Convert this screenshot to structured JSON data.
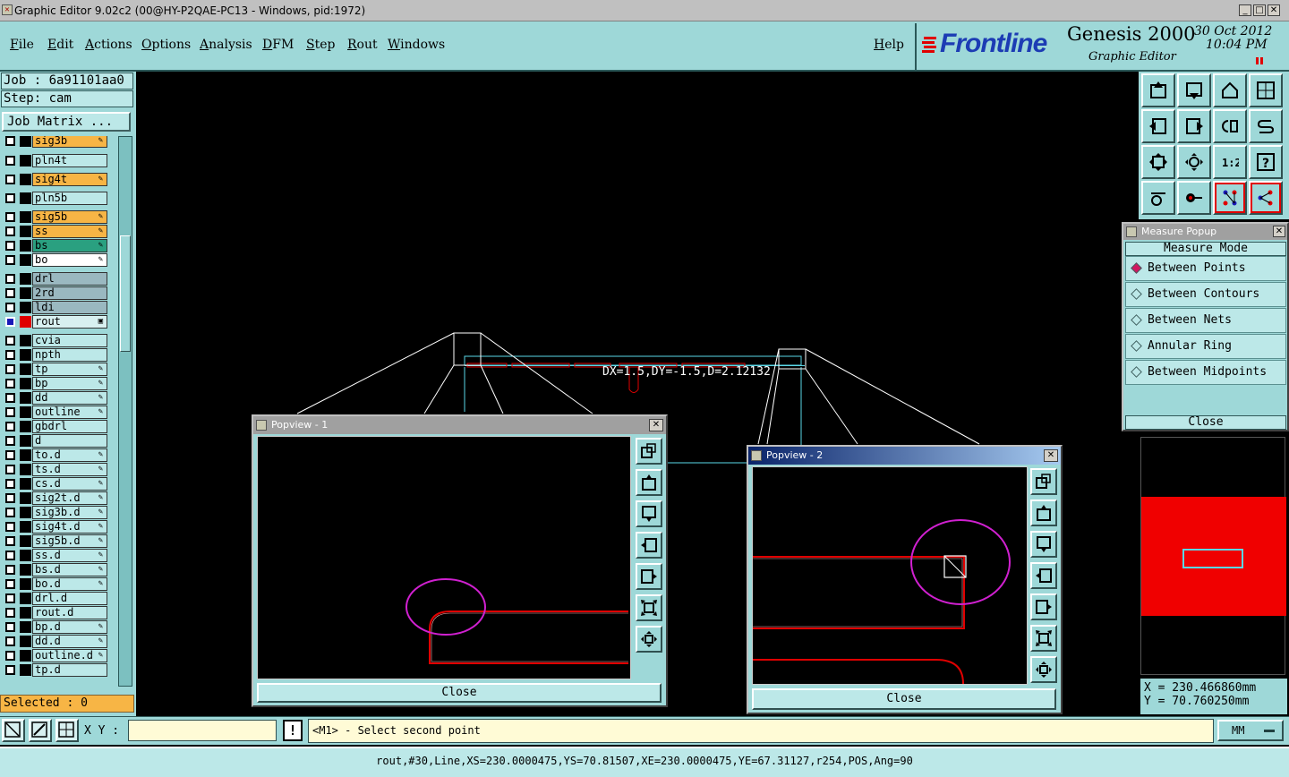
{
  "window": {
    "title": "Graphic Editor 9.02c2 (00@HY-P2QAE-PC13 - Windows, pid:1972)",
    "min": "_",
    "max": "□",
    "close": "✕"
  },
  "menu": {
    "items": [
      "File",
      "Edit",
      "Actions",
      "Options",
      "Analysis",
      "DFM",
      "Step",
      "Rout",
      "Windows"
    ],
    "help": "Help"
  },
  "brand": {
    "logo": "Frontline",
    "product": "Genesis 2000",
    "module": "Graphic Editor",
    "date": "30 Oct 2012",
    "time": "10:04 PM",
    "logo_color": "#1c3cb4",
    "pause_color": "#e00000"
  },
  "job": {
    "job_label": "Job : 6a91101aa0",
    "step_label": "Step: cam",
    "matrix_button": "Job Matrix ..."
  },
  "layers": [
    {
      "name": "sig3b",
      "color": "#f7b545",
      "edit": true
    },
    {
      "name": "pln4t",
      "color": "#bce8e8",
      "edit": false
    },
    {
      "name": "sig4t",
      "color": "#f7b545",
      "edit": true
    },
    {
      "name": "pln5b",
      "color": "#bce8e8",
      "edit": false
    },
    {
      "name": "sig5b",
      "color": "#f7b545",
      "edit": true
    },
    {
      "name": "ss",
      "color": "#f7b545",
      "edit": true
    },
    {
      "name": "bs",
      "color": "#2aa080",
      "edit": true
    },
    {
      "name": "bo",
      "color": "#ffffff",
      "edit": true
    },
    {
      "name": "drl",
      "color": "#9ab8c0",
      "edit": false
    },
    {
      "name": "2rd",
      "color": "#9ab8c0",
      "edit": false
    },
    {
      "name": "ldi",
      "color": "#9ab8c0",
      "edit": false
    },
    {
      "name": "rout",
      "color": "#d8f0f0",
      "edit": false,
      "selected": true
    },
    {
      "name": "cvia",
      "color": "#bce8e8",
      "edit": false
    },
    {
      "name": "npth",
      "color": "#bce8e8",
      "edit": false
    },
    {
      "name": "tp",
      "color": "#bce8e8",
      "edit": true
    },
    {
      "name": "bp",
      "color": "#bce8e8",
      "edit": true
    },
    {
      "name": "dd",
      "color": "#bce8e8",
      "edit": true
    },
    {
      "name": "outline",
      "color": "#bce8e8",
      "edit": true
    },
    {
      "name": "gbdrl",
      "color": "#bce8e8",
      "edit": false
    },
    {
      "name": "d",
      "color": "#bce8e8",
      "edit": false
    },
    {
      "name": "to.d",
      "color": "#bce8e8",
      "edit": true
    },
    {
      "name": "ts.d",
      "color": "#bce8e8",
      "edit": true
    },
    {
      "name": "cs.d",
      "color": "#bce8e8",
      "edit": true
    },
    {
      "name": "sig2t.d",
      "color": "#bce8e8",
      "edit": true
    },
    {
      "name": "sig3b.d",
      "color": "#bce8e8",
      "edit": true
    },
    {
      "name": "sig4t.d",
      "color": "#bce8e8",
      "edit": true
    },
    {
      "name": "sig5b.d",
      "color": "#bce8e8",
      "edit": true
    },
    {
      "name": "ss.d",
      "color": "#bce8e8",
      "edit": true
    },
    {
      "name": "bs.d",
      "color": "#bce8e8",
      "edit": true
    },
    {
      "name": "bo.d",
      "color": "#bce8e8",
      "edit": true
    },
    {
      "name": "drl.d",
      "color": "#bce8e8",
      "edit": false
    },
    {
      "name": "rout.d",
      "color": "#bce8e8",
      "edit": false
    },
    {
      "name": "bp.d",
      "color": "#bce8e8",
      "edit": true
    },
    {
      "name": "dd.d",
      "color": "#bce8e8",
      "edit": true
    },
    {
      "name": "outline.d",
      "color": "#bce8e8",
      "edit": true
    },
    {
      "name": "tp.d",
      "color": "#bce8e8",
      "edit": false
    }
  ],
  "selected_count": "Selected : 0",
  "canvas": {
    "measure_text": "DX=1.5,DY=-1.5,D=2.12132"
  },
  "measure_popup": {
    "title": "Measure Popup",
    "mode_label": "Measure Mode",
    "options": [
      "Between Points",
      "Between Contours",
      "Between Nets",
      "Annular Ring",
      "Between Midpoints"
    ],
    "active_index": 0,
    "close_label": "Close"
  },
  "popview1": {
    "title": "Popview - 1",
    "close_label": "Close"
  },
  "popview2": {
    "title": "Popview - 2",
    "close_label": "Close"
  },
  "coords": {
    "x": "X = 230.466860mm",
    "y": "Y = 70.760250mm"
  },
  "command": {
    "xy_label": "X Y :",
    "xy_value": "",
    "prompt": "<M1> - Select second point",
    "units": "MM"
  },
  "status": "rout,#30,Line,XS=230.0000475,YS=70.81507,XE=230.0000475,YE=67.31127,r254,POS,Ang=90",
  "colors": {
    "panel": "#9ed8d8",
    "accent_red": "#e00000",
    "magenta": "#d020d0",
    "cyan_wire": "#5ad8e8"
  }
}
